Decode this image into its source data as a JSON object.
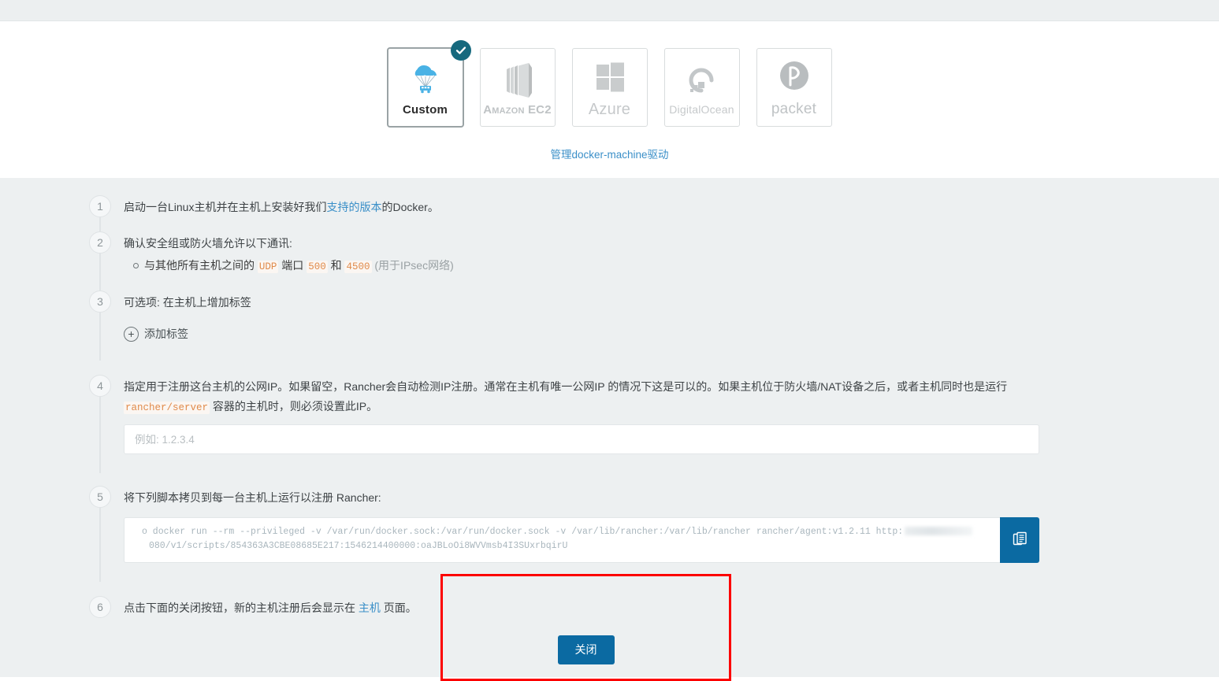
{
  "drivers": {
    "items": [
      {
        "label": "Custom",
        "icon": "cloud-parachute-icon",
        "selected": true
      },
      {
        "label": "Amazon EC2",
        "icon": "amazon-ec2-icon",
        "selected": false
      },
      {
        "label": "Azure",
        "icon": "azure-icon",
        "selected": false
      },
      {
        "label": "DigitalOcean",
        "icon": "digitalocean-icon",
        "selected": false
      },
      {
        "label": "packet",
        "icon": "packet-icon",
        "selected": false
      }
    ],
    "manage_link": "管理docker-machine驱动"
  },
  "steps": [
    {
      "num": "1",
      "text_a": "启动一台Linux主机并在主机上安装好我们",
      "link": "支持的版本",
      "text_b": "的Docker。"
    },
    {
      "num": "2",
      "text": "确认安全组或防火墙允许以下通讯:",
      "bullet": {
        "a": "与其他所有主机之间的",
        "code_udp": "UDP",
        "b": "端口",
        "code_500": "500",
        "c": "和",
        "code_4500": "4500",
        "d": "(用于IPsec网络)"
      }
    },
    {
      "num": "3",
      "text": "可选项: 在主机上增加标签",
      "add_label_button": "添加标签",
      "plus_glyph": "+"
    },
    {
      "num": "4",
      "text_a": "指定用于注册这台主机的公网IP。如果留空，Rancher会自动检测IP注册。通常在主机有唯一公网IP 的情况下这是可以的。如果主机位于防火墙/NAT设备之后，或者主机同时也是运行",
      "code": "rancher/server",
      "text_b": "容器的主机时，则必须设置此IP。",
      "input_placeholder": "例如: 1.2.3.4",
      "input_value": ""
    },
    {
      "num": "5",
      "text": "将下列脚本拷贝到每一台主机上运行以注册 Rancher:",
      "script_line1_pre": "o docker run --rm --privileged -v /var/run/docker.sock:/var/run/docker.sock -v /var/lib/rancher:/var/lib/rancher rancher/agent:v1.2.11 http:",
      "script_line1_post": "",
      "script_line2": "080/v1/scripts/854363A3CBE08685E217:1546214400000:oaJBLoOi8WVVmsb4I3SUxrbqirU",
      "copy_icon": "copy-icon"
    },
    {
      "num": "6",
      "text_a": "点击下面的关闭按钮，新的主机注册后会显示在",
      "link": "主机",
      "text_b": "页面。",
      "close_button": "关闭"
    }
  ],
  "colors": {
    "accent_blue": "#0b6aa2",
    "link_blue": "#3a8fc8",
    "code_orange": "#e08a4a",
    "highlight_red": "#fc0000",
    "check_teal": "#16697e",
    "body_gray": "#edf0f1"
  }
}
